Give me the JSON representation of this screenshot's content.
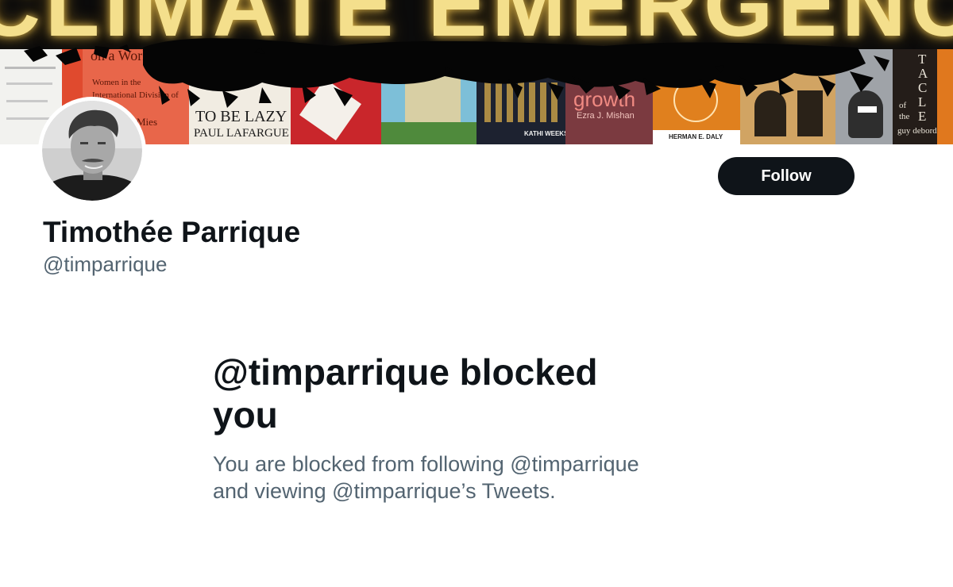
{
  "banner": {
    "headline": "CLIMATE EMERGENCY",
    "book_titles": {
      "women": "on a World",
      "women_sub": "Women in the International Division of Labour",
      "lazy": "TO BE LAZY",
      "lafargue": "PAUL LAFARGUE",
      "weeks": "KATHI WEEKS",
      "growth": "growth",
      "mishan": "Ezra J. Mishan",
      "daly": "HERMAN E. DALY",
      "spectacle": "TACLE",
      "of_the": "of the",
      "debord": "guy debord",
      "mies": "Mies"
    }
  },
  "profile": {
    "display_name": "Timothée Parrique",
    "handle": "@timparrique",
    "follow_label": "Follow"
  },
  "blocked_notice": {
    "title": "@timparrique blocked you",
    "description": "You are blocked from following @timparrique and viewing @timparrique’s Tweets."
  },
  "colors": {
    "text_primary": "#0f1419",
    "text_secondary": "#536471",
    "button_bg": "#0f1419",
    "headline_glow": "#f4df8c"
  }
}
